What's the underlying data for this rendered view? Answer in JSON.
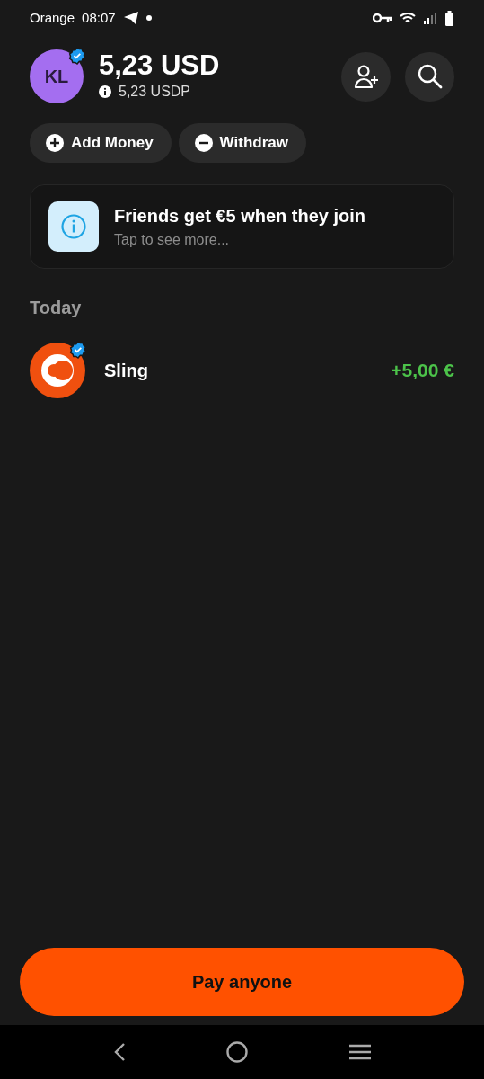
{
  "status_bar": {
    "carrier": "Orange",
    "time": "08:07"
  },
  "account": {
    "initials": "KL",
    "verified": true,
    "balance": "5,23 USD",
    "sub_balance": "5,23 USDP"
  },
  "actions": [
    {
      "label": "Add Money",
      "kind": "add"
    },
    {
      "label": "Withdraw",
      "kind": "withdraw"
    }
  ],
  "promo": {
    "title": "Friends get €5 when they join",
    "subtitle": "Tap to see more..."
  },
  "sections": [
    {
      "title": "Today",
      "transactions": [
        {
          "name": "Sling",
          "verified": true,
          "amount": "+5,00 €",
          "kind": "credit"
        }
      ]
    }
  ],
  "primary_button": "Pay anyone"
}
